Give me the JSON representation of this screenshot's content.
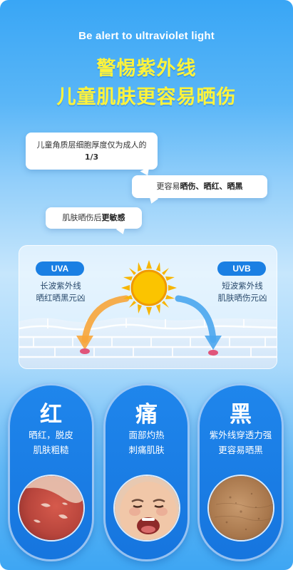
{
  "header": {
    "en_title": "Be alert to ultraviolet light",
    "cn_title_line1": "警惕紫外线",
    "cn_title_line2": "儿童肌肤更容易晒伤"
  },
  "bubbles": {
    "b1_line1": "儿童角质层细胞厚度仅为成人的",
    "b1_line2": "1/3",
    "b2_prefix": "更容易",
    "b2_bold": "晒伤、晒红、晒黑",
    "b3_prefix": "肌肤晒伤后",
    "b3_bold": "更敏感"
  },
  "uv": {
    "uva_label": "UVA",
    "uva_line1": "长波紫外线",
    "uva_line2": "晒红晒黑元凶",
    "uvb_label": "UVB",
    "uvb_line1": "短波紫外线",
    "uvb_line2": "肌肤晒伤元凶"
  },
  "cards": [
    {
      "title": "红",
      "line1": "晒红，脱皮",
      "line2": "肌肤粗糙",
      "icon": "sunburned-skin-photo"
    },
    {
      "title": "痛",
      "line1": "面部灼热",
      "line2": "刺痛肌肤",
      "icon": "crying-child-photo"
    },
    {
      "title": "黑",
      "line1": "紫外线穿透力强",
      "line2": "更容易晒黑",
      "icon": "tanned-skin-photo"
    }
  ],
  "colors": {
    "title_yellow": "#fff33b",
    "accent_blue": "#1a7fe3",
    "arrow_orange": "#f7a53a",
    "arrow_blue": "#4aa6ee"
  }
}
